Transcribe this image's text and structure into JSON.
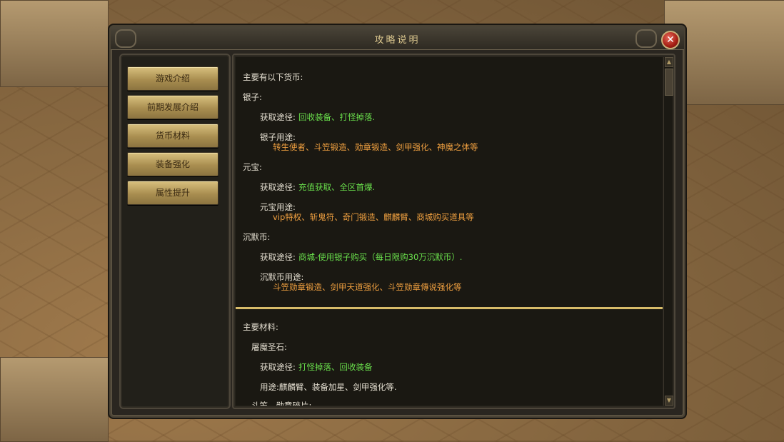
{
  "window": {
    "title": "攻略说明",
    "close_label": "✕"
  },
  "nav": [
    {
      "label": "游戏介绍"
    },
    {
      "label": "前期发展介绍"
    },
    {
      "label": "货币材料"
    },
    {
      "label": "装备强化"
    },
    {
      "label": "属性提升"
    }
  ],
  "currency": {
    "heading": "主要有以下货币:",
    "silver": {
      "title": "银子:",
      "source_label": "获取途径:",
      "source_value": "回收装备、打怪掉落.",
      "use_label": "银子用途:",
      "use_value": "转生使者、斗笠锻造、勋章锻造、剑甲强化、神魔之体等"
    },
    "ingot": {
      "title": "元宝:",
      "source_label": "获取途径:",
      "source_value": "充值获取、全区首爆.",
      "use_label": "元宝用途:",
      "use_value": "vip特权、斩鬼符、奇门锻造、麒麟臂、商城购买道具等"
    },
    "silent": {
      "title": "沉默币:",
      "source_label": "获取途径:",
      "source_value": "商城-使用银子购买（每日限购30万沉默币）.",
      "use_label": "沉默币用途:",
      "use_value": "斗笠勋章锻造、剑甲天道强化、斗笠勋章傳说强化等"
    }
  },
  "materials": {
    "heading": "主要材料:",
    "stone": {
      "title": "屠魔圣石:",
      "source_label": "获取途径:",
      "source_value": "打怪掉落、回收装备",
      "use_text": "用途:麒麟臂、装备加星、剑甲强化等."
    },
    "next_partial": "斗笠、勋章碎片:"
  },
  "colors": {
    "text": "#e6e0d2",
    "highlight_green": "#6ae04c",
    "highlight_orange": "#f0a040",
    "divider": "#d8bc6a"
  }
}
